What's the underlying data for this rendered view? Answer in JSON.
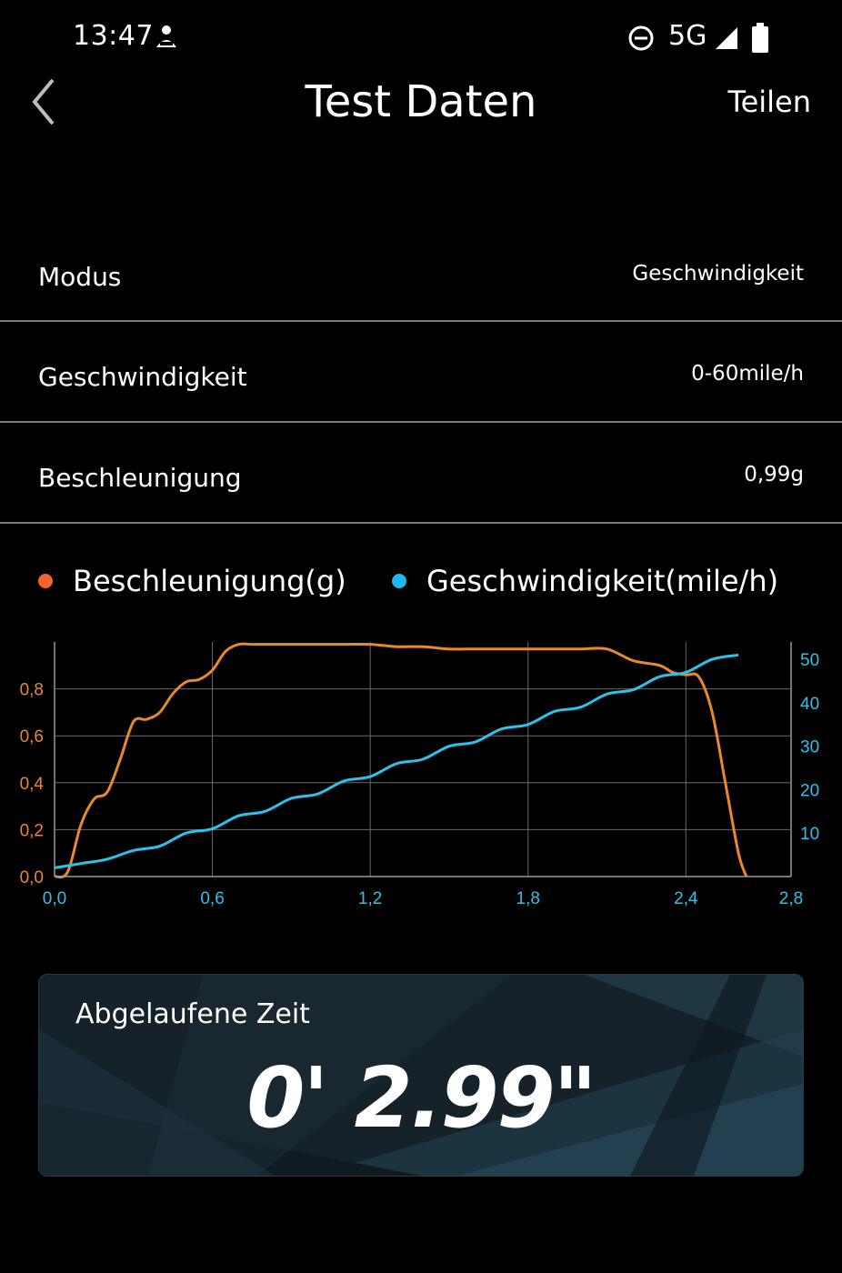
{
  "status_bar": {
    "time": "13:47",
    "network": "5G"
  },
  "header": {
    "title": "Test Daten",
    "share_label": "Teilen"
  },
  "rows": [
    {
      "label": "Modus",
      "value": "Geschwindigkeit"
    },
    {
      "label": "Geschwindigkeit",
      "value": "0-60mile/h"
    },
    {
      "label": "Beschleunigung",
      "value": "0,99g"
    }
  ],
  "colors": {
    "acceleration": "#e8892c",
    "speed": "#2cc2ea",
    "legend_accel_dot": "#f0652a",
    "legend_speed_dot": "#1fb7ee"
  },
  "chart_data": {
    "type": "line",
    "x_ticks": [
      "0,0",
      "0,6",
      "1,2",
      "1,8",
      "2,4",
      "2,8"
    ],
    "y_left_ticks": [
      "0,0",
      "0,2",
      "0,4",
      "0,6",
      "0,8"
    ],
    "y_right_ticks": [
      "10",
      "20",
      "30",
      "40",
      "50"
    ],
    "xlim": [
      0,
      2.8
    ],
    "ylim_left": [
      0,
      1.0
    ],
    "ylim_right": [
      0,
      54
    ],
    "grid": true,
    "series": [
      {
        "name": "Beschleunigung(g)",
        "axis": "left",
        "x": [
          0.0,
          0.05,
          0.1,
          0.15,
          0.2,
          0.25,
          0.3,
          0.35,
          0.4,
          0.45,
          0.5,
          0.55,
          0.6,
          0.65,
          0.7,
          0.75,
          0.8,
          0.9,
          1.0,
          1.1,
          1.2,
          1.3,
          1.4,
          1.5,
          1.6,
          1.7,
          1.8,
          1.9,
          2.0,
          2.1,
          2.2,
          2.3,
          2.35,
          2.4,
          2.45,
          2.5,
          2.55,
          2.6,
          2.63
        ],
        "values": [
          0.0,
          0.02,
          0.22,
          0.33,
          0.36,
          0.5,
          0.66,
          0.67,
          0.7,
          0.78,
          0.83,
          0.84,
          0.88,
          0.96,
          0.99,
          0.99,
          0.99,
          0.99,
          0.99,
          0.99,
          0.99,
          0.98,
          0.98,
          0.97,
          0.97,
          0.97,
          0.97,
          0.97,
          0.97,
          0.97,
          0.92,
          0.9,
          0.87,
          0.86,
          0.85,
          0.7,
          0.4,
          0.1,
          0.0
        ]
      },
      {
        "name": "Geschwindigkeit(mile/h)",
        "axis": "right",
        "x": [
          0.0,
          0.1,
          0.2,
          0.3,
          0.4,
          0.5,
          0.6,
          0.7,
          0.8,
          0.9,
          1.0,
          1.1,
          1.2,
          1.3,
          1.4,
          1.5,
          1.6,
          1.7,
          1.8,
          1.9,
          2.0,
          2.1,
          2.2,
          2.3,
          2.4,
          2.5,
          2.6
        ],
        "values": [
          2,
          3,
          4,
          6,
          7,
          10,
          11,
          14,
          15,
          18,
          19,
          22,
          23,
          26,
          27,
          30,
          31,
          34,
          35,
          38,
          39,
          42,
          43,
          46,
          47,
          50,
          51
        ]
      }
    ]
  },
  "timer": {
    "label": "Abgelaufene Zeit",
    "value": "0' 2.99\""
  }
}
